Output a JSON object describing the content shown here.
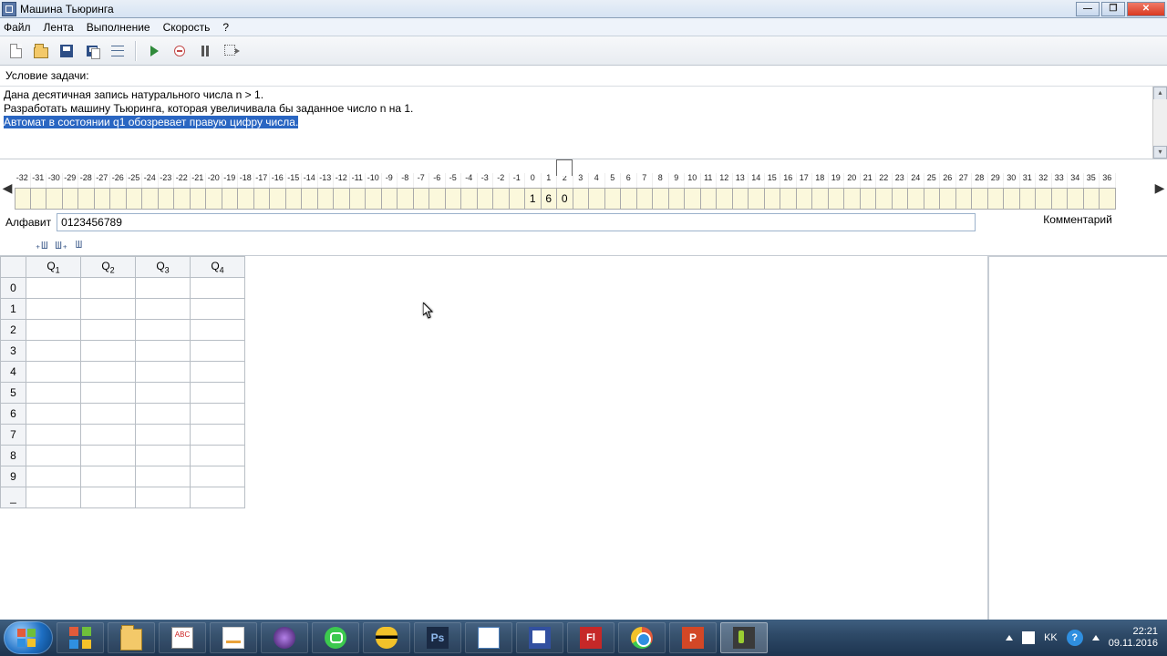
{
  "window": {
    "title": "Машина Тьюринга"
  },
  "menu": {
    "file": "Файл",
    "tape": "Лента",
    "run": "Выполнение",
    "speed": "Скорость",
    "help": "?"
  },
  "condition": {
    "label": "Условие задачи:",
    "line1": "Дана десятичная запись натурального числа n > 1.",
    "line2": "Разработать машину Тьюринга, которая увеличивала бы заданное число n на 1.",
    "line3": "Автомат в состоянии q1 обозревает правую цифру числа."
  },
  "tape": {
    "indices": [
      "-32",
      "-31",
      "-30",
      "-29",
      "-28",
      "-27",
      "-26",
      "-25",
      "-24",
      "-23",
      "-22",
      "-21",
      "-20",
      "-19",
      "-18",
      "-17",
      "-16",
      "-15",
      "-14",
      "-13",
      "-12",
      "-11",
      "-10",
      "-9",
      "-8",
      "-7",
      "-6",
      "-5",
      "-4",
      "-3",
      "-2",
      "-1",
      "0",
      "1",
      "2",
      "3",
      "4",
      "5",
      "6",
      "7",
      "8",
      "9",
      "10",
      "11",
      "12",
      "13",
      "14",
      "15",
      "16",
      "17",
      "18",
      "19",
      "20",
      "21",
      "22",
      "23",
      "24",
      "25",
      "26",
      "27",
      "28",
      "29",
      "30",
      "31",
      "32",
      "33",
      "34",
      "35",
      "36"
    ],
    "values": {
      "0": "1",
      "1": "6",
      "2": "0"
    },
    "head": 2
  },
  "alphabet": {
    "label": "Алфавит",
    "value": "0123456789"
  },
  "comment": {
    "label": "Комментарий"
  },
  "table_toolbar": {
    "add_left": "₊Ш",
    "add_right": "Ш₊",
    "del": "Ш"
  },
  "rules": {
    "states": [
      "Q1",
      "Q2",
      "Q3",
      "Q4"
    ],
    "symbols": [
      "0",
      "1",
      "2",
      "3",
      "4",
      "5",
      "6",
      "7",
      "8",
      "9",
      "_"
    ]
  },
  "tray": {
    "lang": "KK",
    "time": "22:21",
    "date": "09.11.2016"
  }
}
